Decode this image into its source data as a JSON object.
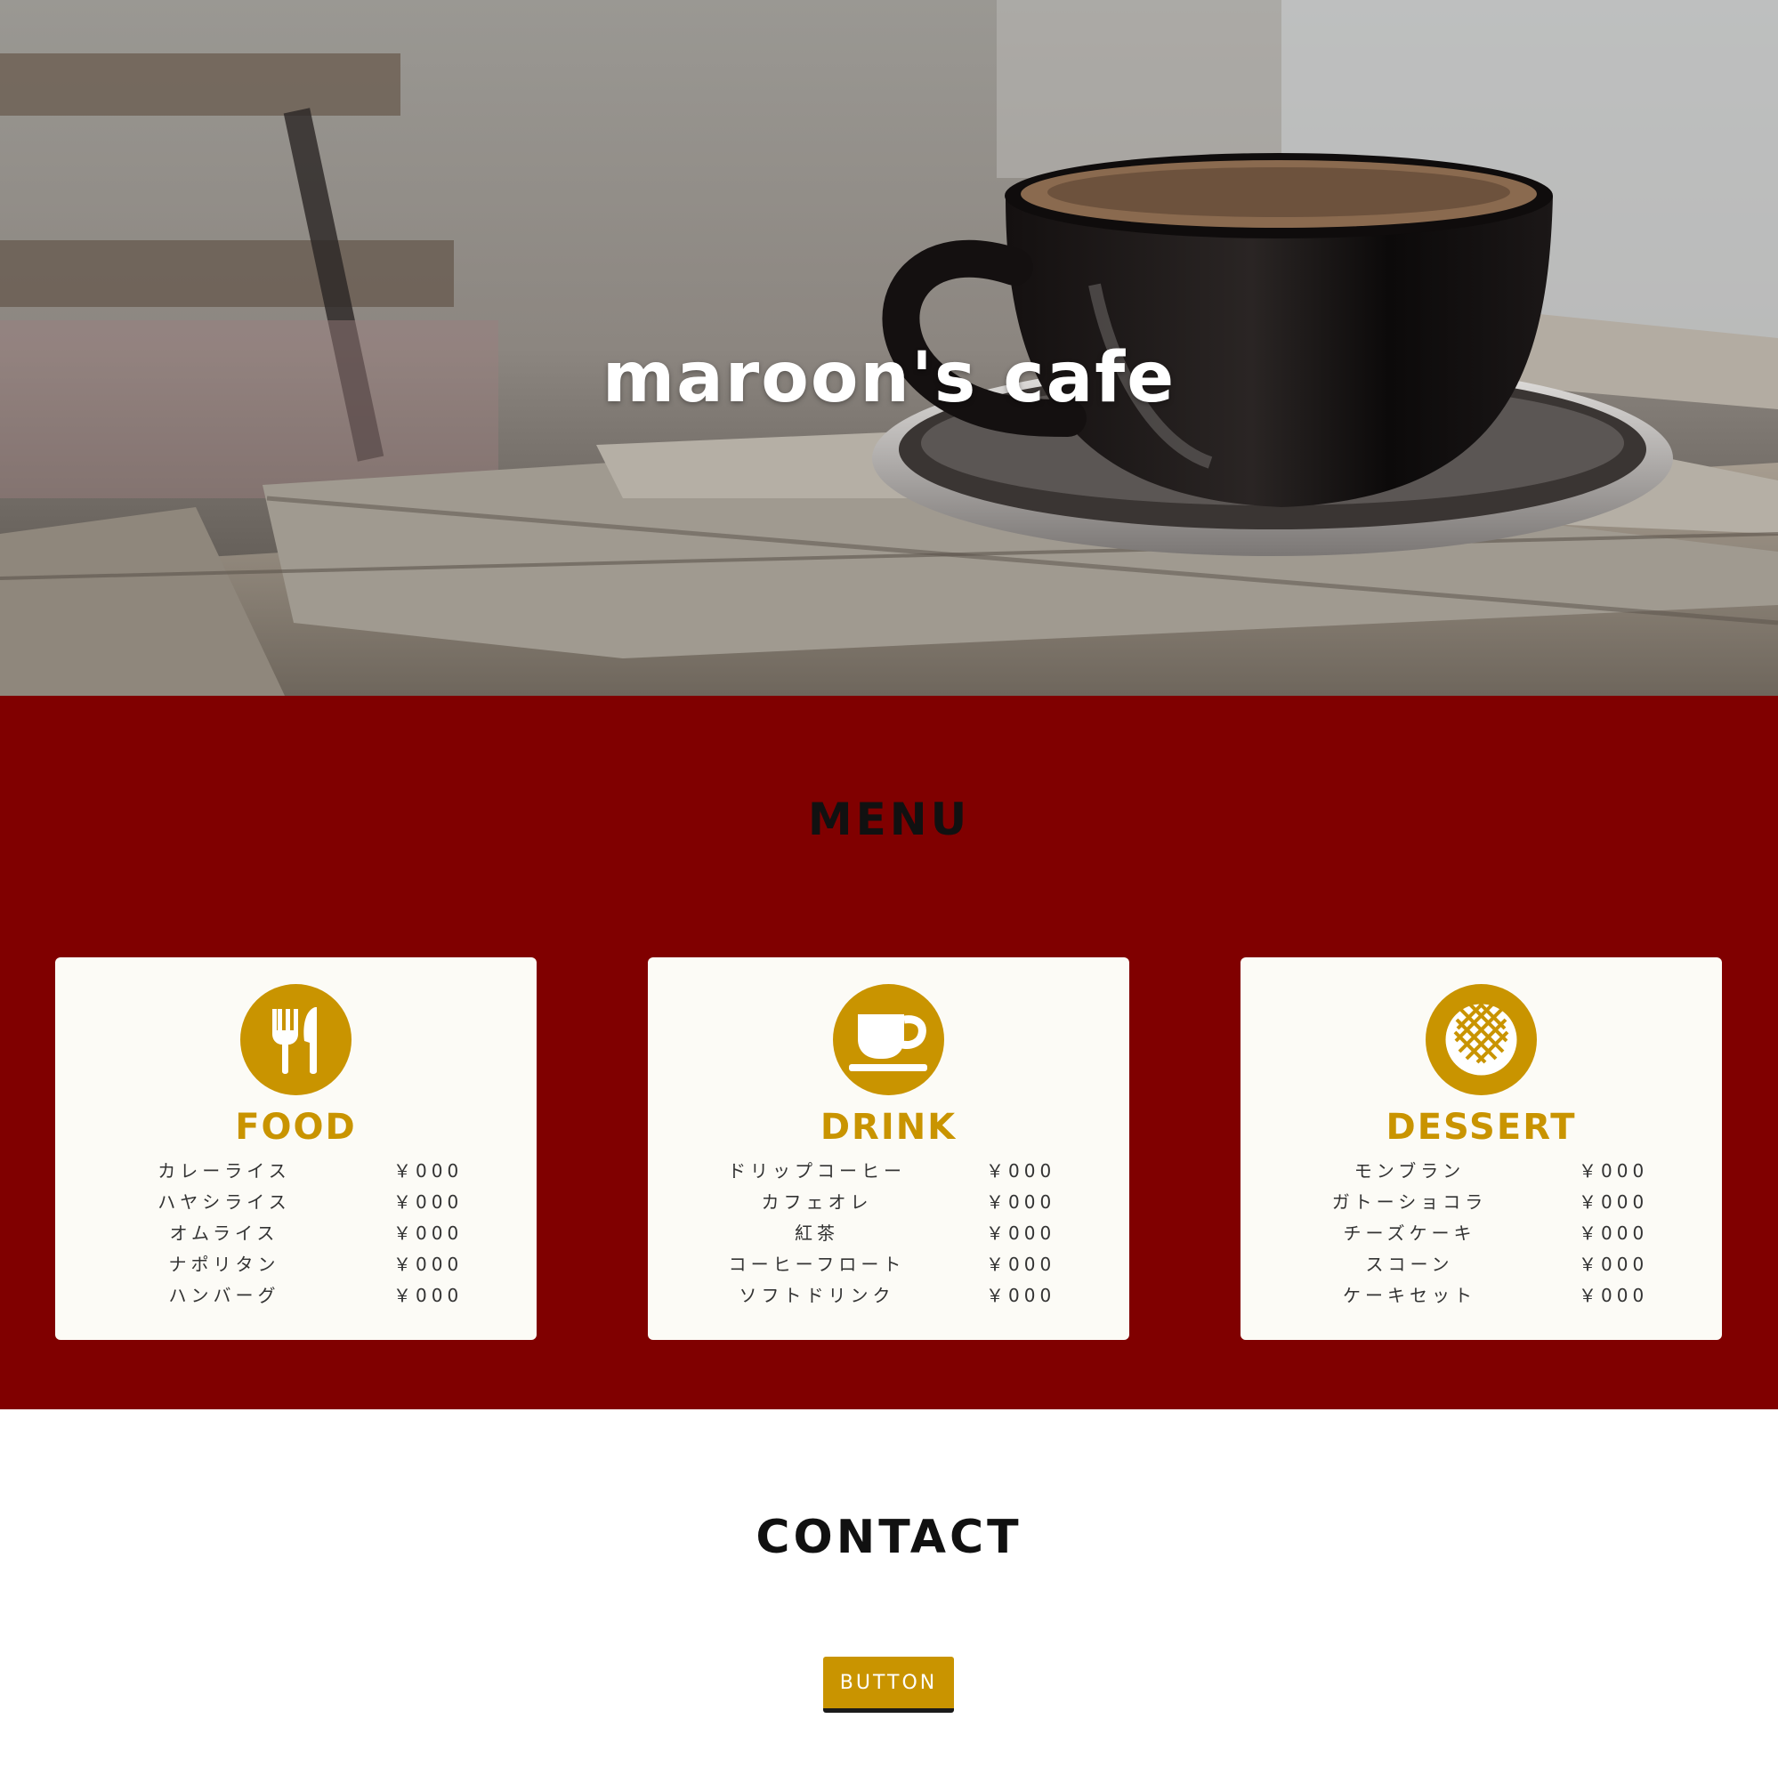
{
  "hero": {
    "title": "maroon's cafe"
  },
  "menu": {
    "title": "MENU",
    "cards": [
      {
        "title": "FOOD",
        "icon": "fork-knife-icon",
        "items": [
          {
            "name": "カレーライス",
            "price": "￥000"
          },
          {
            "name": "ハヤシライス",
            "price": "￥000"
          },
          {
            "name": "オムライス",
            "price": "￥000"
          },
          {
            "name": "ナポリタン",
            "price": "￥000"
          },
          {
            "name": "ハンバーグ",
            "price": "￥000"
          }
        ]
      },
      {
        "title": "DRINK",
        "icon": "coffee-cup-icon",
        "items": [
          {
            "name": "ドリップコーヒー",
            "price": "￥000"
          },
          {
            "name": "カフェオレ",
            "price": "￥000"
          },
          {
            "name": "紅茶",
            "price": "￥000"
          },
          {
            "name": "コーヒーフロート",
            "price": "￥000"
          },
          {
            "name": "ソフトドリンク",
            "price": "￥000"
          }
        ]
      },
      {
        "title": "DESSERT",
        "icon": "waffle-icon",
        "items": [
          {
            "name": "モンブラン",
            "price": "￥000"
          },
          {
            "name": "ガトーショコラ",
            "price": "￥000"
          },
          {
            "name": "チーズケーキ",
            "price": "￥000"
          },
          {
            "name": "スコーン",
            "price": "￥000"
          },
          {
            "name": "ケーキセット",
            "price": "￥000"
          }
        ]
      }
    ]
  },
  "contact": {
    "title": "CONTACT",
    "button_label": "BUTTON"
  },
  "colors": {
    "maroon": "#800000",
    "gold": "#c99400",
    "card_bg": "#fcfbf6"
  }
}
